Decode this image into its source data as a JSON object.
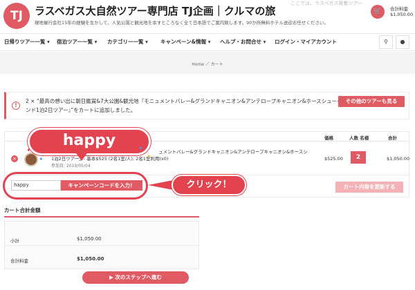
{
  "header": {
    "logo_text": "TJ",
    "site_title": "ラスベガス大自然ツアー専門店 TJ企画｜クルマの旅",
    "site_description": "現地催行会社15年の経験を生かして、人気公園と観光地を余すところなく全て日本語でご案内致します。90か所無料ホテル送迎お任せください。",
    "top_faint_text": "ここでは、ラスベガス発着ツアー",
    "cart_label": "合計料金",
    "cart_amount": "$1,050.00"
  },
  "nav": {
    "items": [
      {
        "label": "日帰りツアー一覧 ▾"
      },
      {
        "label": "宿泊ツアー一覧 ▾"
      },
      {
        "label": "カテゴリー一覧 ▾"
      },
      {
        "label": "キャンペーン&情報 ▾"
      },
      {
        "label": "ヘルプ・お問合せ ▾"
      },
      {
        "label": "ログイン・マイアカウント"
      }
    ],
    "search_icon": "search-icon",
    "user_icon": "user-icon"
  },
  "breadcrumb": "Home ／ カート",
  "notice": {
    "text": "2 × “最高の想い出に朝日鑑賞&7大公園&観光地『モニュメントバレー&グランドキャニオン&アンテロープキャニオン&ホースシューベンド1泊2日ツアー』”をカートに追加しました。",
    "button_label": "その他のツアーも見る"
  },
  "cart_table": {
    "headers": {
      "price": "価格",
      "qty": "人数 名様",
      "total": "合計"
    },
    "row": {
      "title_line1": "ュメントバレー&グランドキャニオン&アンテロープキャニオン&ホースシ",
      "title_line2": "1泊2日ツアー』- 基本$525 (2名1室/人), 2名1室利用(x0)",
      "title_line3": "参加日: 2019/05/04",
      "price": "$525.00",
      "qty": "2",
      "subtotal": "$1,050.00"
    },
    "coupon_value": "happy",
    "coupon_button": "キャンペーンコードを入力！",
    "update_button": "カート内容を更新する"
  },
  "annotations": {
    "bubble_text": "happy",
    "click_text": "クリック！"
  },
  "totals": {
    "title": "カート合計金額",
    "subtotal_label": "小計",
    "subtotal_value": "$1,050.00",
    "total_label": "合計料金",
    "total_value": "$1,050.00",
    "next_button": "▶ 次のステップへ進む"
  },
  "colors": {
    "accent": "#e05a63",
    "annotation": "#e3434e"
  }
}
